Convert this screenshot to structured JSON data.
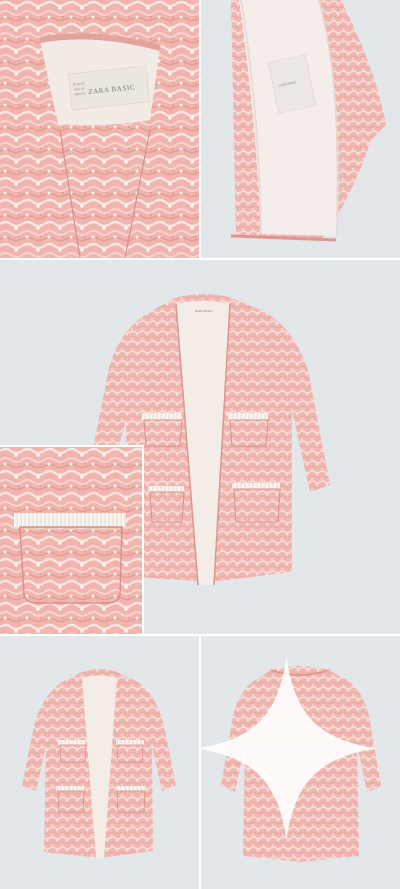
{
  "collage": {
    "panels": [
      {
        "id": "neck-closeup",
        "subject": "collar-detail"
      },
      {
        "id": "lining-closeup",
        "subject": "lining-detail"
      },
      {
        "id": "front-full",
        "subject": "coat-front"
      },
      {
        "id": "pocket-closeup",
        "subject": "pocket-detail"
      },
      {
        "id": "front-small",
        "subject": "coat-front"
      },
      {
        "id": "back-small",
        "subject": "coat-back"
      }
    ]
  },
  "garment_label": {
    "brand": "ZARA BASIC",
    "size_codes": [
      "EUR XS",
      "USA XS",
      "MEX 24"
    ]
  },
  "colors": {
    "background": "#e4e7ea",
    "tweed_pink": "#f1bcb7",
    "tweed_light": "#f8dcd7",
    "lining": "#f3ece8",
    "fringe": "#f5efe8"
  },
  "icons": {
    "watermark": "sparkle-icon"
  }
}
